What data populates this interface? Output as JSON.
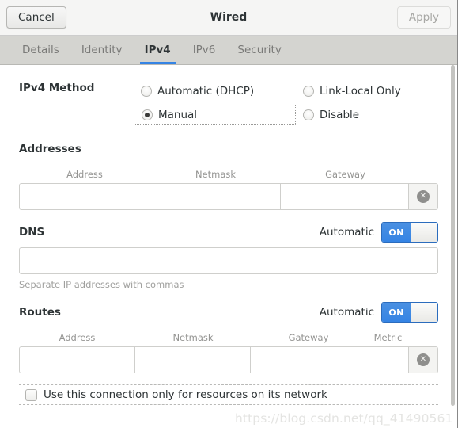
{
  "header": {
    "title": "Wired",
    "cancel_label": "Cancel",
    "apply_label": "Apply"
  },
  "tabs": [
    {
      "label": "Details",
      "active": false
    },
    {
      "label": "Identity",
      "active": false
    },
    {
      "label": "IPv4",
      "active": true
    },
    {
      "label": "IPv6",
      "active": false
    },
    {
      "label": "Security",
      "active": false
    }
  ],
  "method": {
    "label": "IPv4 Method",
    "options": [
      {
        "label": "Automatic (DHCP)",
        "selected": false,
        "focused": false
      },
      {
        "label": "Link-Local Only",
        "selected": false,
        "focused": false
      },
      {
        "label": "Manual",
        "selected": true,
        "focused": true
      },
      {
        "label": "Disable",
        "selected": false,
        "focused": false
      }
    ]
  },
  "addresses": {
    "title": "Addresses",
    "columns": [
      "Address",
      "Netmask",
      "Gateway"
    ],
    "rows": [
      {
        "address": "",
        "netmask": "",
        "gateway": ""
      }
    ],
    "delete_icon": "✕"
  },
  "dns": {
    "title": "DNS",
    "automatic_label": "Automatic",
    "toggle_state": "ON",
    "value": "",
    "hint": "Separate IP addresses with commas"
  },
  "routes": {
    "title": "Routes",
    "automatic_label": "Automatic",
    "toggle_state": "ON",
    "columns": [
      "Address",
      "Netmask",
      "Gateway",
      "Metric"
    ],
    "rows": [
      {
        "address": "",
        "netmask": "",
        "gateway": "",
        "metric": ""
      }
    ],
    "delete_icon": "✕"
  },
  "restrict": {
    "label": "Use this connection only for resources on its network",
    "checked": false
  },
  "watermark": "https://blog.csdn.net/qq_41490561",
  "colors": {
    "accent": "#3584e4",
    "headerbar": "#f5f5f4",
    "tabbar": "#d4d4d0",
    "text": "#2e3436",
    "muted": "#949492"
  }
}
